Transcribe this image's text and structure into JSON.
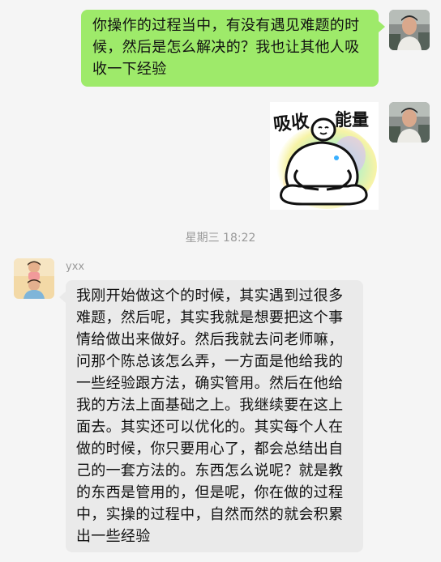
{
  "messages": {
    "m1": {
      "text": "你操作的过程当中，有没有遇见难题的时候，然后是怎么解决的？我也让其他人吸收一下经验"
    },
    "m2": {
      "sticker_left": "吸收",
      "sticker_right": "能量"
    },
    "time_divider": "星期三 18:22",
    "m3": {
      "sender": "yxx",
      "text": "我刚开始做这个的时候，其实遇到过很多难题，然后呢，其实我就是想要把这个事情给做出来做好。然后我就去问老师嘛，问那个陈总该怎么弄，一方面是他给我的一些经验跟方法，确实管用。然后在他给我的方法上面基础之上。我继续要在这上面去。其实还可以优化的。其实每个人在做的时候，你只要用心了，都会总结出自己的一套方法的。东西怎么说呢？就是教的东西是管用的，但是呢，你在做的过程中，实操的过程中，自然而然的就会积累出一些经验"
    }
  },
  "colors": {
    "own_bubble": "#9eea6a",
    "other_bubble": "#eaeaea",
    "background": "#f5f5f5"
  }
}
